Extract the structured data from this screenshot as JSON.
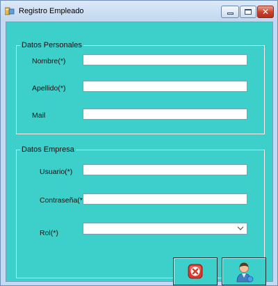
{
  "window": {
    "title": "Registro Empleado",
    "colors": {
      "client_bg": "#3dcfc9",
      "group_border": "#ffffff"
    }
  },
  "personal": {
    "legend": "Datos Personales",
    "nombre_label": "Nombre(*)",
    "nombre_value": "",
    "apellido_label": "Apellido(*)",
    "apellido_value": "",
    "mail_label": "Mail",
    "mail_value": ""
  },
  "empresa": {
    "legend": "Datos Empresa",
    "usuario_label": "Usuario(*)",
    "usuario_value": "",
    "password_label": "Contraseña(*)",
    "password_value": "",
    "rol_label": "Rol(*)",
    "rol_selected": ""
  },
  "actions": {
    "cancel_icon": "red-x-icon",
    "save_icon": "user-icon"
  }
}
